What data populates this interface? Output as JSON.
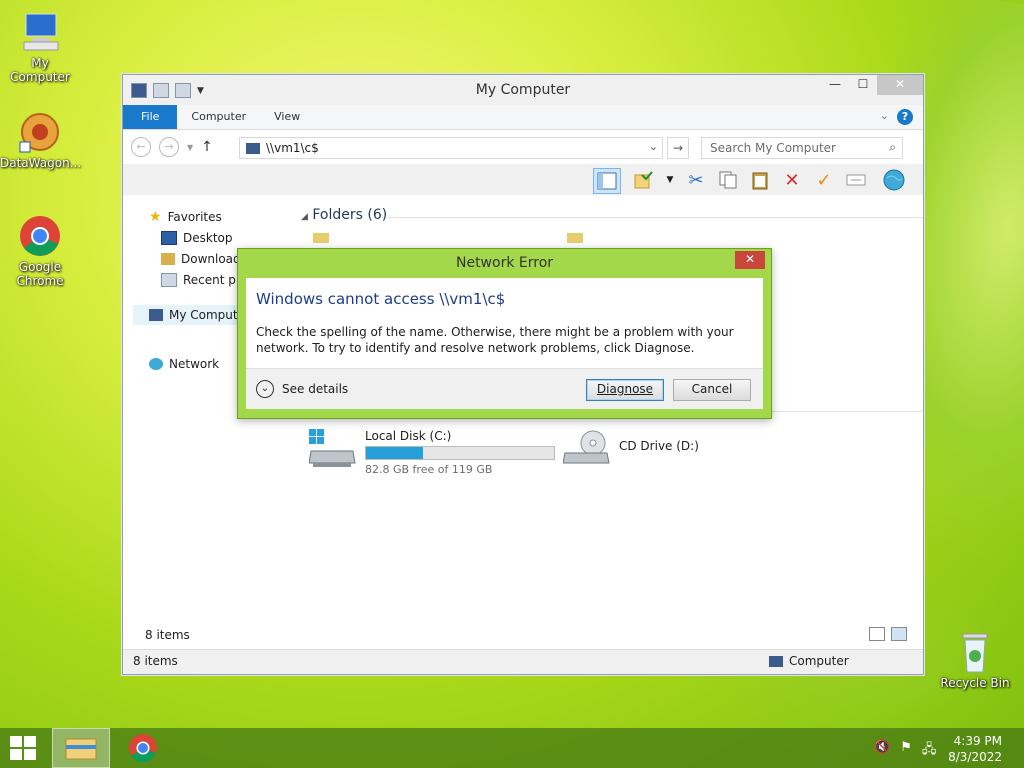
{
  "desktop": {
    "icons": [
      {
        "label": "My Computer"
      },
      {
        "label": "DataWagon..."
      },
      {
        "label": "Google Chrome"
      },
      {
        "label": "Recycle Bin"
      }
    ]
  },
  "window": {
    "title": "My Computer",
    "tabs": [
      "File",
      "Computer",
      "View"
    ],
    "address": "\\\\vm1\\c$",
    "search_placeholder": "Search My Computer",
    "nav": {
      "favorites": "Favorites",
      "desktop": "Desktop",
      "downloads": "Downloads",
      "recent": "Recent places",
      "computer": "My Computer",
      "network": "Network"
    },
    "folders_header": "Folders (6)",
    "drives": [
      {
        "name": "Local Disk (C:)",
        "free": "82.8 GB free of 119 GB",
        "used_fraction": 0.304
      },
      {
        "name": "CD Drive (D:)"
      }
    ],
    "status_items": "8 items",
    "status_items2": "8 items",
    "status_location": "Computer"
  },
  "dialog": {
    "title": "Network Error",
    "heading": "Windows cannot access \\\\vm1\\c$",
    "message": "Check the spelling of the name. Otherwise, there might be a problem with your network. To try to identify and resolve network problems, click Diagnose.",
    "details": "See details",
    "diagnose": "Diagnose",
    "cancel": "Cancel"
  },
  "taskbar": {
    "time": "4:39 PM",
    "date": "8/3/2022"
  }
}
